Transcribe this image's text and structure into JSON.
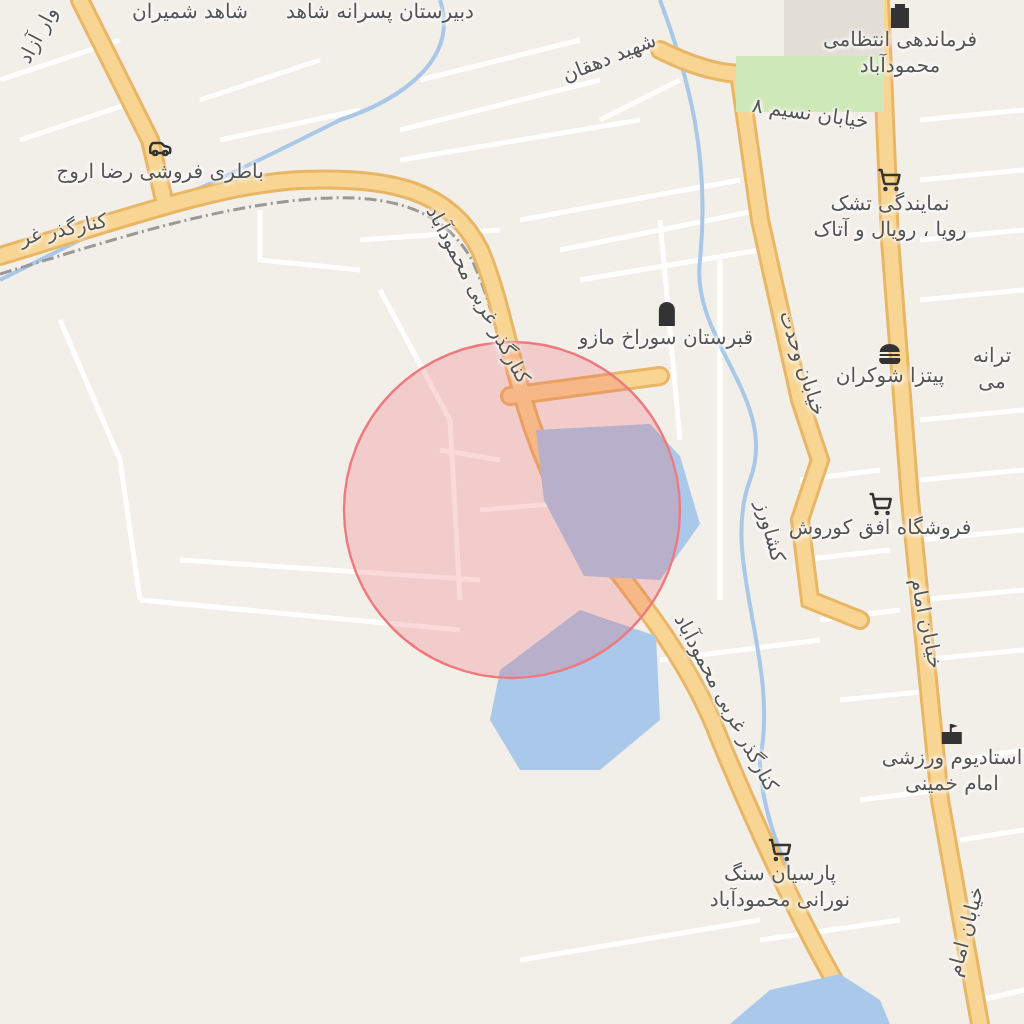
{
  "map": {
    "streets": [
      {
        "text": "وار آزاد"
      },
      {
        "text": "دبیرستان پسرانه شاهد"
      },
      {
        "text": "شاهد شمیران"
      },
      {
        "text": "شهید دهقان"
      },
      {
        "text": "خیابان نسیم ۸"
      },
      {
        "text": "کنارگذر غر"
      },
      {
        "text": "کنارگذر غربی محمودآباد"
      },
      {
        "text": "خیابان وحدت"
      },
      {
        "text": "کشاورز"
      },
      {
        "text": "خیابان امام"
      },
      {
        "text": "کنارگذر غربی محمودآباد"
      },
      {
        "text": "خیابان امام"
      }
    ],
    "places": [
      {
        "kind": "car",
        "lines": [
          "باطری فروشی رضا اروج"
        ]
      },
      {
        "kind": "police",
        "lines": [
          "فرماندهی انتظامی",
          "محمودآباد"
        ]
      },
      {
        "kind": "shop",
        "lines": [
          "نمایندگی تشک",
          "رویا ، رویال و آتاک"
        ]
      },
      {
        "kind": "cemetery",
        "lines": [
          "قبرستان سوراخ مازو"
        ]
      },
      {
        "kind": "fastfood",
        "lines": [
          "پیتزا شوکران"
        ]
      },
      {
        "kind": "none",
        "lines": [
          "ترانه",
          "می"
        ]
      },
      {
        "kind": "shop",
        "lines": [
          "فروشگاه افق کوروش"
        ]
      },
      {
        "kind": "stadium",
        "lines": [
          "استادیوم ورزشی",
          "امام خمینی"
        ]
      },
      {
        "kind": "shop",
        "lines": [
          "پارسیان سنگ",
          "نورانی محمودآباد"
        ]
      }
    ]
  }
}
